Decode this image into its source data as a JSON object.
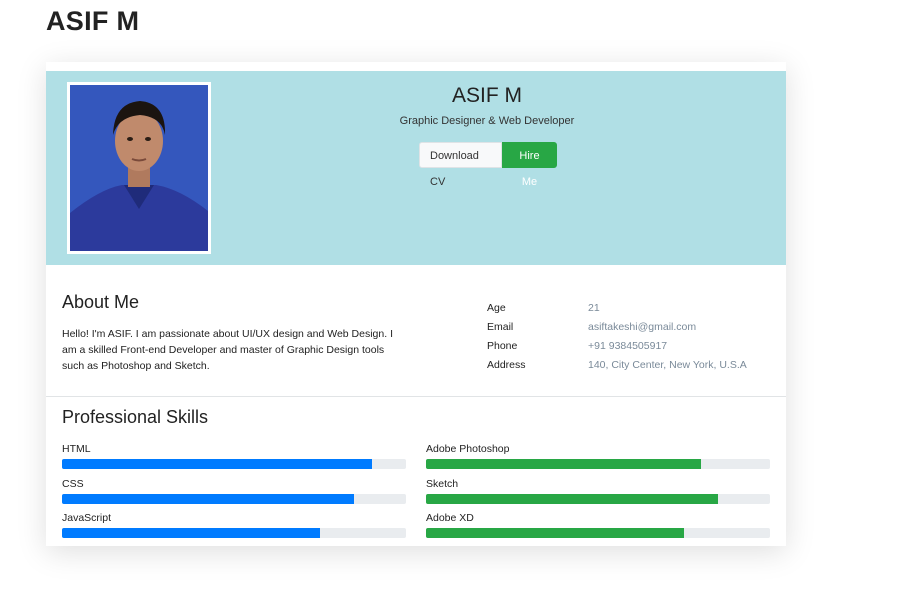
{
  "page": {
    "title": "ASIF M"
  },
  "hero": {
    "name": "ASIF M",
    "role": "Graphic Designer & Web Developer",
    "download_label": "Download CV",
    "hire_label": "Hire Me"
  },
  "about": {
    "title": "About Me",
    "text": "Hello! I'm ASIF. I am passionate about UI/UX design and Web Design. I am a skilled Front-end Developer and master of Graphic Design tools such as Photoshop and Sketch.",
    "info": [
      {
        "key": "Age",
        "value": "21"
      },
      {
        "key": "Email",
        "value": "asiftakeshi@gmail.com"
      },
      {
        "key": "Phone",
        "value": "+91 9384505917"
      },
      {
        "key": "Address",
        "value": "140, City Center, New York, U.S.A"
      }
    ]
  },
  "skills": {
    "title": "Professional Skills",
    "left": [
      {
        "name": "HTML",
        "level": 0.9,
        "color": "#007bff"
      },
      {
        "name": "CSS",
        "level": 0.85,
        "color": "#007bff"
      },
      {
        "name": "JavaScript",
        "level": 0.75,
        "color": "#007bff"
      }
    ],
    "right": [
      {
        "name": "Adobe Photoshop",
        "level": 0.8,
        "color": "#28a745"
      },
      {
        "name": "Sketch",
        "level": 0.85,
        "color": "#28a745"
      },
      {
        "name": "Adobe XD",
        "level": 0.75,
        "color": "#28a745"
      }
    ]
  }
}
